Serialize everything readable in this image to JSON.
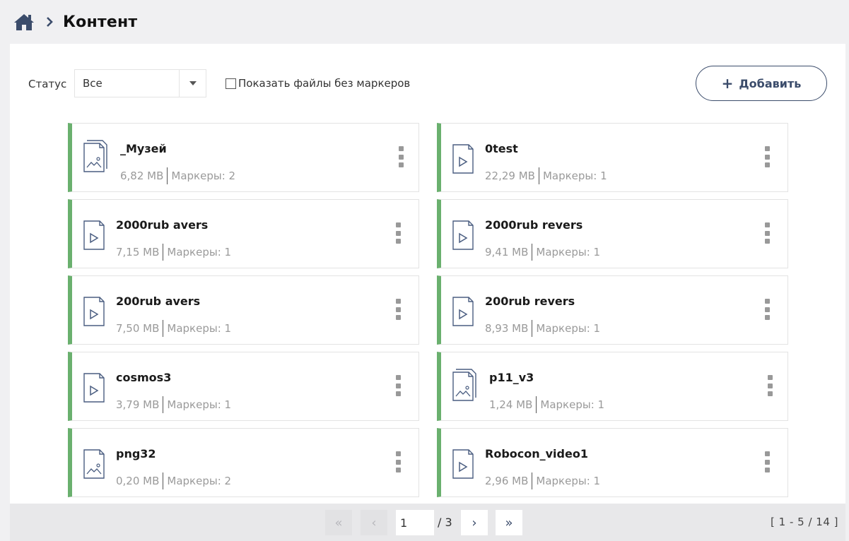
{
  "breadcrumb": {
    "title": "Контент"
  },
  "toolbar": {
    "status_label": "Статус",
    "status_value": "Все",
    "checkbox_label": "Показать файлы без маркеров",
    "add_label": "Добавить"
  },
  "files": [
    {
      "name": "_Музей",
      "size": "6,82 MB",
      "markers": "Маркеры: 2",
      "type": "image-multi"
    },
    {
      "name": "0test",
      "size": "22,29 MB",
      "markers": "Маркеры: 1",
      "type": "video"
    },
    {
      "name": "2000rub avers",
      "size": "7,15 MB",
      "markers": "Маркеры: 1",
      "type": "video"
    },
    {
      "name": "2000rub revers",
      "size": "9,41 MB",
      "markers": "Маркеры: 1",
      "type": "video"
    },
    {
      "name": "200rub avers",
      "size": "7,50 MB",
      "markers": "Маркеры: 1",
      "type": "video"
    },
    {
      "name": "200rub revers",
      "size": "8,93 MB",
      "markers": "Маркеры: 1",
      "type": "video"
    },
    {
      "name": "cosmos3",
      "size": "3,79 MB",
      "markers": "Маркеры: 1",
      "type": "video"
    },
    {
      "name": "p11_v3",
      "size": "1,24 MB",
      "markers": "Маркеры: 1",
      "type": "image-multi"
    },
    {
      "name": "png32",
      "size": "0,20 MB",
      "markers": "Маркеры: 2",
      "type": "image"
    },
    {
      "name": "Robocon_video1",
      "size": "2,96 MB",
      "markers": "Маркеры: 1",
      "type": "video"
    }
  ],
  "pager": {
    "first_icon": "«",
    "prev_icon": "‹",
    "page": "1",
    "total": "/ 3",
    "next_icon": "›",
    "last_icon": "»",
    "range": "[ 1 - 5 / 14 ]"
  },
  "colors": {
    "accent": "#6ab06e",
    "brand": "#3b4c6b"
  }
}
